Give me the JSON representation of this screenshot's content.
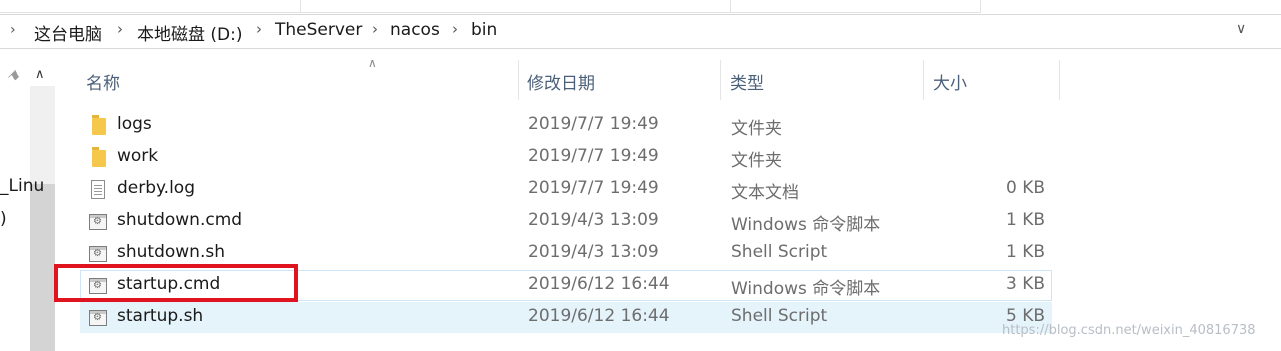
{
  "breadcrumb": {
    "items": [
      "这台电脑",
      "本地磁盘 (D:)",
      "TheServer",
      "nacos",
      "bin"
    ]
  },
  "nav_fragments": [
    "_Linu",
    ")"
  ],
  "columns": {
    "name": "名称",
    "date": "修改日期",
    "type": "类型",
    "size": "大小"
  },
  "files": [
    {
      "name": "logs",
      "date": "2019/7/7 19:49",
      "type": "文件夹",
      "size": "",
      "icon": "folder-icon"
    },
    {
      "name": "work",
      "date": "2019/7/7 19:49",
      "type": "文件夹",
      "size": "",
      "icon": "folder-icon"
    },
    {
      "name": "derby.log",
      "date": "2019/7/7 19:49",
      "type": "文本文档",
      "size": "0 KB",
      "icon": "text-file-icon"
    },
    {
      "name": "shutdown.cmd",
      "date": "2019/4/3 13:09",
      "type": "Windows 命令脚本",
      "size": "1 KB",
      "icon": "script-file-icon"
    },
    {
      "name": "shutdown.sh",
      "date": "2019/4/3 13:09",
      "type": "Shell Script",
      "size": "1 KB",
      "icon": "script-file-icon"
    },
    {
      "name": "startup.cmd",
      "date": "2019/6/12 16:44",
      "type": "Windows 命令脚本",
      "size": "3 KB",
      "icon": "script-file-icon"
    },
    {
      "name": "startup.sh",
      "date": "2019/6/12 16:44",
      "type": "Shell Script",
      "size": "5 KB",
      "icon": "script-file-icon"
    }
  ],
  "watermark": "https://blog.csdn.net/weixin_40816738",
  "colors": {
    "highlight": "#e0141e",
    "selected_row": "#e5f3fb",
    "hover_border": "#cfe6f8",
    "header_text": "#4c607a",
    "folder": "#f5c84b"
  }
}
